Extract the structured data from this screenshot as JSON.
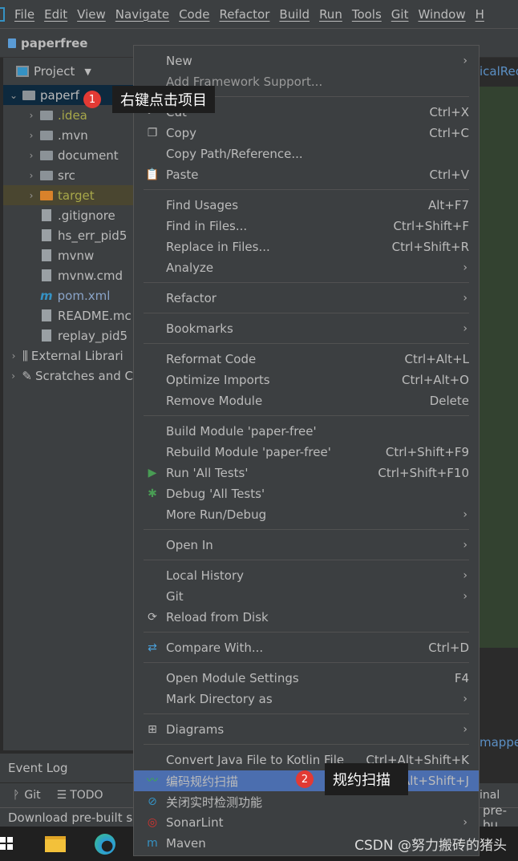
{
  "menubar": {
    "items": [
      "File",
      "Edit",
      "View",
      "Navigate",
      "Code",
      "Refactor",
      "Build",
      "Run",
      "Tools",
      "Git",
      "Window",
      "H"
    ]
  },
  "nav": {
    "project_name": "paperfree"
  },
  "project_panel": {
    "title": "Project",
    "tree": [
      {
        "label": "paperf",
        "depth": 0,
        "type": "module",
        "expanded": true,
        "color": "#bbbbbb"
      },
      {
        "label": ".idea",
        "depth": 1,
        "type": "folder",
        "color": "#a8a84a"
      },
      {
        "label": ".mvn",
        "depth": 1,
        "type": "folder",
        "color": "#bbbbbb"
      },
      {
        "label": "document",
        "depth": 1,
        "type": "folder",
        "color": "#bbbbbb"
      },
      {
        "label": "src",
        "depth": 1,
        "type": "folder",
        "color": "#bbbbbb"
      },
      {
        "label": "target",
        "depth": 1,
        "type": "folder-excluded",
        "color": "#a8a84a"
      },
      {
        "label": ".gitignore",
        "depth": 2,
        "type": "file",
        "color": "#bbbbbb"
      },
      {
        "label": "hs_err_pid5",
        "depth": 2,
        "type": "file",
        "color": "#bbbbbb"
      },
      {
        "label": "mvnw",
        "depth": 2,
        "type": "file",
        "color": "#bbbbbb"
      },
      {
        "label": "mvnw.cmd",
        "depth": 2,
        "type": "file",
        "color": "#bbbbbb"
      },
      {
        "label": "pom.xml",
        "depth": 2,
        "type": "maven",
        "color": "#8aa4c8"
      },
      {
        "label": "README.mc",
        "depth": 2,
        "type": "file",
        "color": "#bbbbbb"
      },
      {
        "label": "replay_pid5",
        "depth": 2,
        "type": "file",
        "color": "#bbbbbb"
      },
      {
        "label": "External Librari",
        "depth": 0,
        "type": "library",
        "color": "#bbbbbb"
      },
      {
        "label": "Scratches and C",
        "depth": 0,
        "type": "scratch",
        "color": "#bbbbbb"
      }
    ]
  },
  "editor": {
    "tab_fragment": "icalRec",
    "fragment2": "mappe"
  },
  "event_log": "Event Log",
  "toolstrip": {
    "git": "Git",
    "todo": "TODO",
    "terminal": "inal"
  },
  "status": {
    "text": "Download pre-built sh",
    "right": "pre-bu"
  },
  "context_menu": {
    "items": [
      {
        "label": "New",
        "arrow": true
      },
      {
        "label": "Add Framework Support...",
        "dim": true,
        "sep_after": true
      },
      {
        "label": "Cut",
        "shortcut": "Ctrl+X",
        "icon": "scissors-icon",
        "glyph": "✂"
      },
      {
        "label": "Copy",
        "shortcut": "Ctrl+C",
        "icon": "copy-icon",
        "glyph": "❐"
      },
      {
        "label": "Copy Path/Reference..."
      },
      {
        "label": "Paste",
        "shortcut": "Ctrl+V",
        "icon": "paste-icon",
        "glyph": "📋",
        "sep_after": true
      },
      {
        "label": "Find Usages",
        "shortcut": "Alt+F7"
      },
      {
        "label": "Find in Files...",
        "shortcut": "Ctrl+Shift+F"
      },
      {
        "label": "Replace in Files...",
        "shortcut": "Ctrl+Shift+R"
      },
      {
        "label": "Analyze",
        "arrow": true,
        "sep_after": true
      },
      {
        "label": "Refactor",
        "arrow": true,
        "sep_after": true
      },
      {
        "label": "Bookmarks",
        "arrow": true,
        "sep_after": true
      },
      {
        "label": "Reformat Code",
        "shortcut": "Ctrl+Alt+L"
      },
      {
        "label": "Optimize Imports",
        "shortcut": "Ctrl+Alt+O"
      },
      {
        "label": "Remove Module",
        "shortcut": "Delete",
        "sep_after": true
      },
      {
        "label": "Build Module 'paper-free'"
      },
      {
        "label": "Rebuild Module 'paper-free'",
        "shortcut": "Ctrl+Shift+F9"
      },
      {
        "label": "Run 'All Tests'",
        "shortcut": "Ctrl+Shift+F10",
        "icon": "run-icon",
        "glyph": "▶",
        "icon_color": "#499c54"
      },
      {
        "label": "Debug 'All Tests'",
        "icon": "debug-bug-icon",
        "glyph": "✱",
        "icon_color": "#499c54"
      },
      {
        "label": "More Run/Debug",
        "arrow": true,
        "sep_after": true
      },
      {
        "label": "Open In",
        "arrow": true,
        "sep_after": true
      },
      {
        "label": "Local History",
        "arrow": true
      },
      {
        "label": "Git",
        "arrow": true
      },
      {
        "label": "Reload from Disk",
        "icon": "reload-icon",
        "glyph": "⟳",
        "sep_after": true
      },
      {
        "label": "Compare With...",
        "shortcut": "Ctrl+D",
        "icon": "compare-icon",
        "glyph": "⇄",
        "icon_color": "#4a9fd8",
        "sep_after": true
      },
      {
        "label": "Open Module Settings",
        "shortcut": "F4"
      },
      {
        "label": "Mark Directory as",
        "arrow": true,
        "sep_after": true
      },
      {
        "label": "Diagrams",
        "arrow": true,
        "icon": "diagram-icon",
        "glyph": "⊞",
        "sep_after": true
      },
      {
        "label": "Convert Java File to Kotlin File",
        "shortcut": "Ctrl+Alt+Shift+K"
      },
      {
        "label": "编码规约扫描",
        "shortcut": "Ctrl+Alt+Shift+J",
        "selected": true,
        "icon": "p3c-scan-icon",
        "glyph": "〰",
        "icon_color": "#3cb043"
      },
      {
        "label": "关闭实时检测功能",
        "icon": "disable-icon",
        "glyph": "⊘",
        "icon_color": "#3592c4"
      },
      {
        "label": "SonarLint",
        "arrow": true,
        "icon": "sonarlint-icon",
        "glyph": "◎",
        "icon_color": "#d9322e"
      },
      {
        "label": "Maven",
        "icon": "maven-icon",
        "glyph": "m",
        "icon_color": "#3592c4"
      }
    ]
  },
  "annotations": {
    "step1_num": "1",
    "step1_text": "右键点击项目",
    "step2_num": "2",
    "step2_text": "规约扫描"
  },
  "watermark": "CSDN @努力搬砖的猪头"
}
